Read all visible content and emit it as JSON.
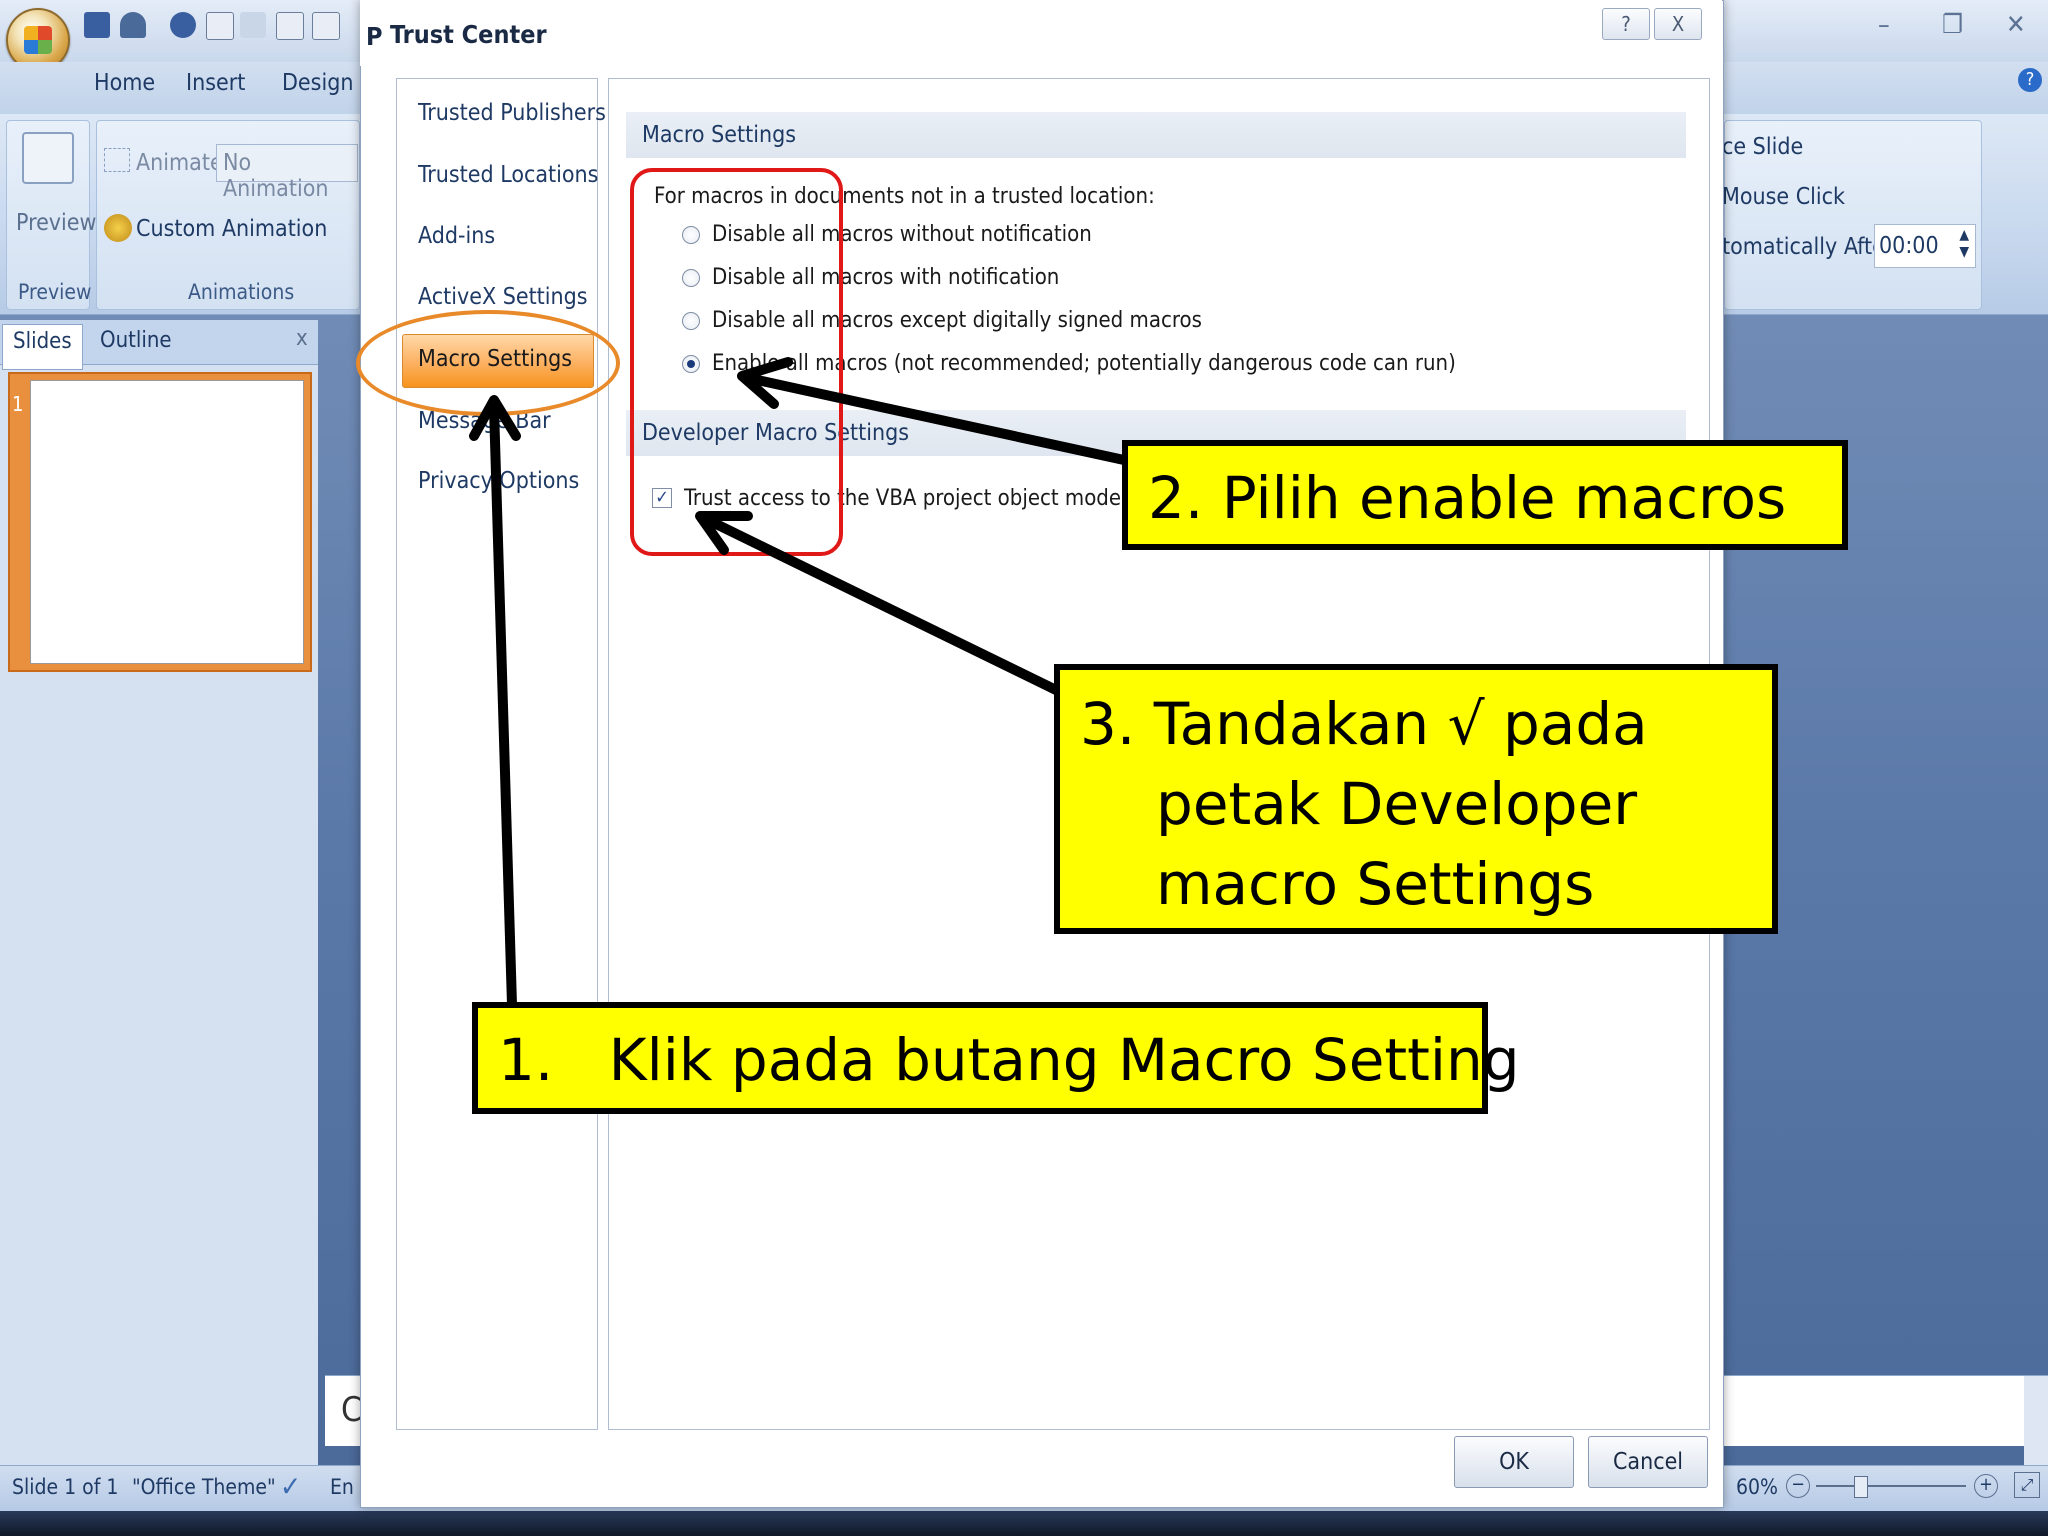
{
  "ppt": {
    "tabs": [
      "Home",
      "Insert",
      "Design"
    ],
    "preview_label": "Preview",
    "preview_group": "Preview",
    "animate_label": "Animate:",
    "animate_value": "No Animation",
    "custom_animation": "Custom Animation",
    "animations_group": "Animations",
    "right_line1": "ce Slide",
    "right_line2": "Mouse Click",
    "right_line3": "tomatically After:",
    "auto_time": "00:00",
    "pane_tabs": [
      "Slides",
      "Outline"
    ],
    "pane_close": "x",
    "slide_number": "1",
    "notes_partial": "C"
  },
  "status": {
    "slide": "Slide 1 of 1",
    "theme": "\"Office Theme\"",
    "lang": "En",
    "zoom": "60%"
  },
  "dialog": {
    "title_prefix": "P",
    "title": "Trust Center",
    "help": "?",
    "close": "X",
    "nav": [
      "Trusted Publishers",
      "Trusted Locations",
      "Add-ins",
      "ActiveX Settings",
      "Macro Settings",
      "Message Bar",
      "Privacy Options"
    ],
    "selected_nav": "Macro Settings",
    "macro_section": "Macro Settings",
    "macro_intro": "For macros in documents not in a trusted location:",
    "options": [
      "Disable all macros without notification",
      "Disable all macros with notification",
      "Disable all macros except digitally signed macros",
      "Enable all macros (not recommended; potentially dangerous code can run)"
    ],
    "selected_option": 3,
    "dev_section": "Developer Macro Settings",
    "dev_checkbox": "Trust access to the VBA project object model",
    "dev_checked": true,
    "ok": "OK",
    "cancel": "Cancel"
  },
  "callouts": {
    "step1": "1.   Klik pada butang Macro Setting",
    "step2": "2. Pilih enable macros",
    "step3_line1": "3. Tandakan √ pada",
    "step3_line2": "petak Developer",
    "step3_line3": "macro Settings"
  },
  "colors": {
    "callout_bg": "#ffff00",
    "highlight_oval": "#e88a2a",
    "red_box": "#e01818",
    "nav_selected": "#f7941d"
  }
}
